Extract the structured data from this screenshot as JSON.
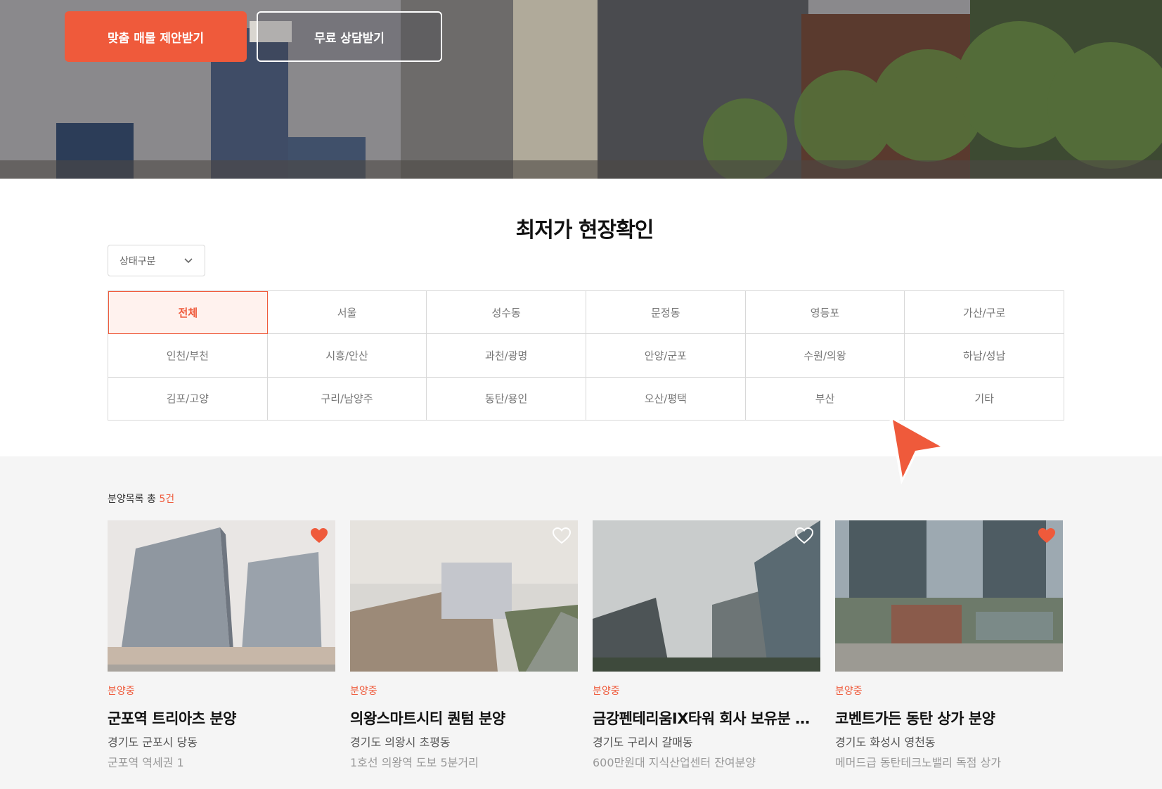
{
  "hero": {
    "primary_button": "맞춤 매물 제안받기",
    "secondary_button": "무료 상담받기"
  },
  "section": {
    "title": "최저가 현장확인"
  },
  "status_filter": {
    "selected": "상태구분",
    "icon": "chevron-down-icon"
  },
  "regions": [
    {
      "label": "전체",
      "active": true
    },
    {
      "label": "서울",
      "active": false
    },
    {
      "label": "성수동",
      "active": false
    },
    {
      "label": "문정동",
      "active": false
    },
    {
      "label": "영등포",
      "active": false
    },
    {
      "label": "가산/구로",
      "active": false
    },
    {
      "label": "인천/부천",
      "active": false
    },
    {
      "label": "시흥/안산",
      "active": false
    },
    {
      "label": "과천/광명",
      "active": false
    },
    {
      "label": "안양/군포",
      "active": false
    },
    {
      "label": "수원/의왕",
      "active": false
    },
    {
      "label": "하남/성남",
      "active": false
    },
    {
      "label": "김포/고양",
      "active": false
    },
    {
      "label": "구리/남양주",
      "active": false
    },
    {
      "label": "동탄/용인",
      "active": false
    },
    {
      "label": "오산/평택",
      "active": false
    },
    {
      "label": "부산",
      "active": false
    },
    {
      "label": "기타",
      "active": false
    }
  ],
  "listing": {
    "count_prefix": "분양목록 총 ",
    "count_value": "5건"
  },
  "cards": [
    {
      "status": "분양중",
      "title": "군포역 트리아츠 분양",
      "address": "경기도 군포시 당동",
      "desc": "군포역 역세권 1",
      "favorite": true
    },
    {
      "status": "분양중",
      "title": "의왕스마트시티 퀀텀 분양",
      "address": "경기도 의왕시 초평동",
      "desc": "1호선 의왕역 도보 5분거리",
      "favorite": false
    },
    {
      "status": "분양중",
      "title": "금강펜테리움IX타워 회사 보유분 분양",
      "address": "경기도 구리시 갈매동",
      "desc": "600만원대 지식산업센터 잔여분양",
      "favorite": false
    },
    {
      "status": "분양중",
      "title": "코벤트가든 동탄 상가 분양",
      "address": "경기도 화성시 영천동",
      "desc": "메머드급 동탄테크노밸리 독점 상가",
      "favorite": true
    }
  ],
  "colors": {
    "accent": "#ef5a3b",
    "grid_border": "#d8d8d8",
    "listing_bg": "#f5f5f5"
  }
}
